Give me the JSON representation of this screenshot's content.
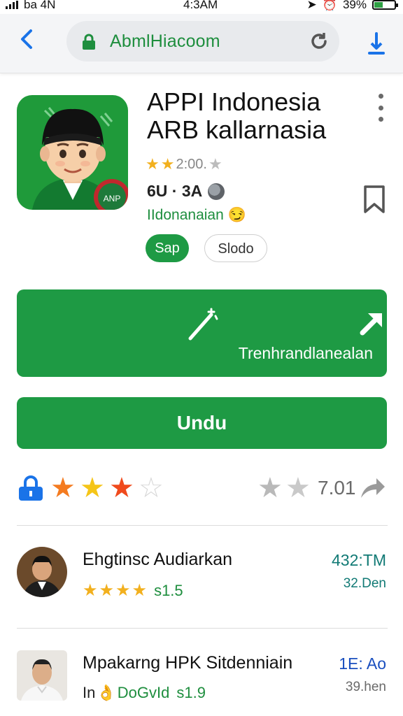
{
  "status_bar": {
    "carrier": "ba 4N",
    "time": "4:3AM",
    "battery": "39%"
  },
  "browser": {
    "url": "AbmlHiacoom"
  },
  "app": {
    "title_line1": "APPI Indonesia",
    "title_line2": "ARB kallarnasia",
    "rating_text": "2:00.",
    "rating_stars": 2,
    "meta": "6U · 3A",
    "category": "IIdonanaian",
    "tags": [
      "Sap",
      "Slodo"
    ],
    "icon_badge": "ANP"
  },
  "actions": {
    "translate_label": "Trenhrandlanealan",
    "download_label": "Undu"
  },
  "rating_bar": {
    "score": "7.01",
    "filled_stars": 3
  },
  "list": [
    {
      "title": "Ehgtinsc Audiarkan",
      "rating": "s1.5",
      "time": "432:TM",
      "price": "32.Den"
    },
    {
      "title": "Mpakarng HPK Sitdenniain",
      "rating": "s1.9",
      "prefix": "In",
      "label": "DoGvId",
      "time": "1E: Ao",
      "price": "39.hen"
    }
  ],
  "colors": {
    "primary": "#1e9a44",
    "link": "#1a73e8",
    "accent_text": "#1e8e3e",
    "star": "#f2b01e",
    "star_orange": "#f47b20",
    "teal": "#117a75"
  }
}
